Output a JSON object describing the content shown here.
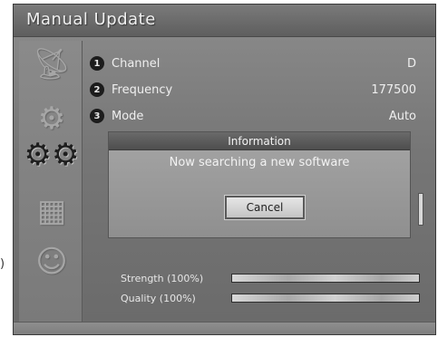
{
  "window": {
    "title": "Manual Update",
    "edge_mark": ")"
  },
  "sidebar": {
    "items": [
      {
        "icon": "satellite-dish-icon",
        "active": false
      },
      {
        "icon": "settings-box-icon",
        "active": false
      },
      {
        "icon": "gears-icon",
        "active": true
      },
      {
        "icon": "calendar-icon",
        "active": false
      },
      {
        "icon": "smiley-icon",
        "active": false
      }
    ]
  },
  "settings": {
    "rows": [
      {
        "number": "1",
        "label": "Channel",
        "value": "D"
      },
      {
        "number": "2",
        "label": "Frequency",
        "value": "177500"
      },
      {
        "number": "3",
        "label": "Mode",
        "value": "Auto"
      }
    ]
  },
  "signal": {
    "strength_label": "Strength (100%)",
    "strength_percent": 100,
    "quality_label": "Quality (100%)",
    "quality_percent": 100
  },
  "dialog": {
    "title": "Information",
    "message": "Now searching a new software",
    "cancel_label": "Cancel"
  },
  "colors": {
    "panel": "#767676",
    "title_bar": "#5e5e5e",
    "dialog_header": "#4e4e4e",
    "button": "#d6d6d6"
  }
}
